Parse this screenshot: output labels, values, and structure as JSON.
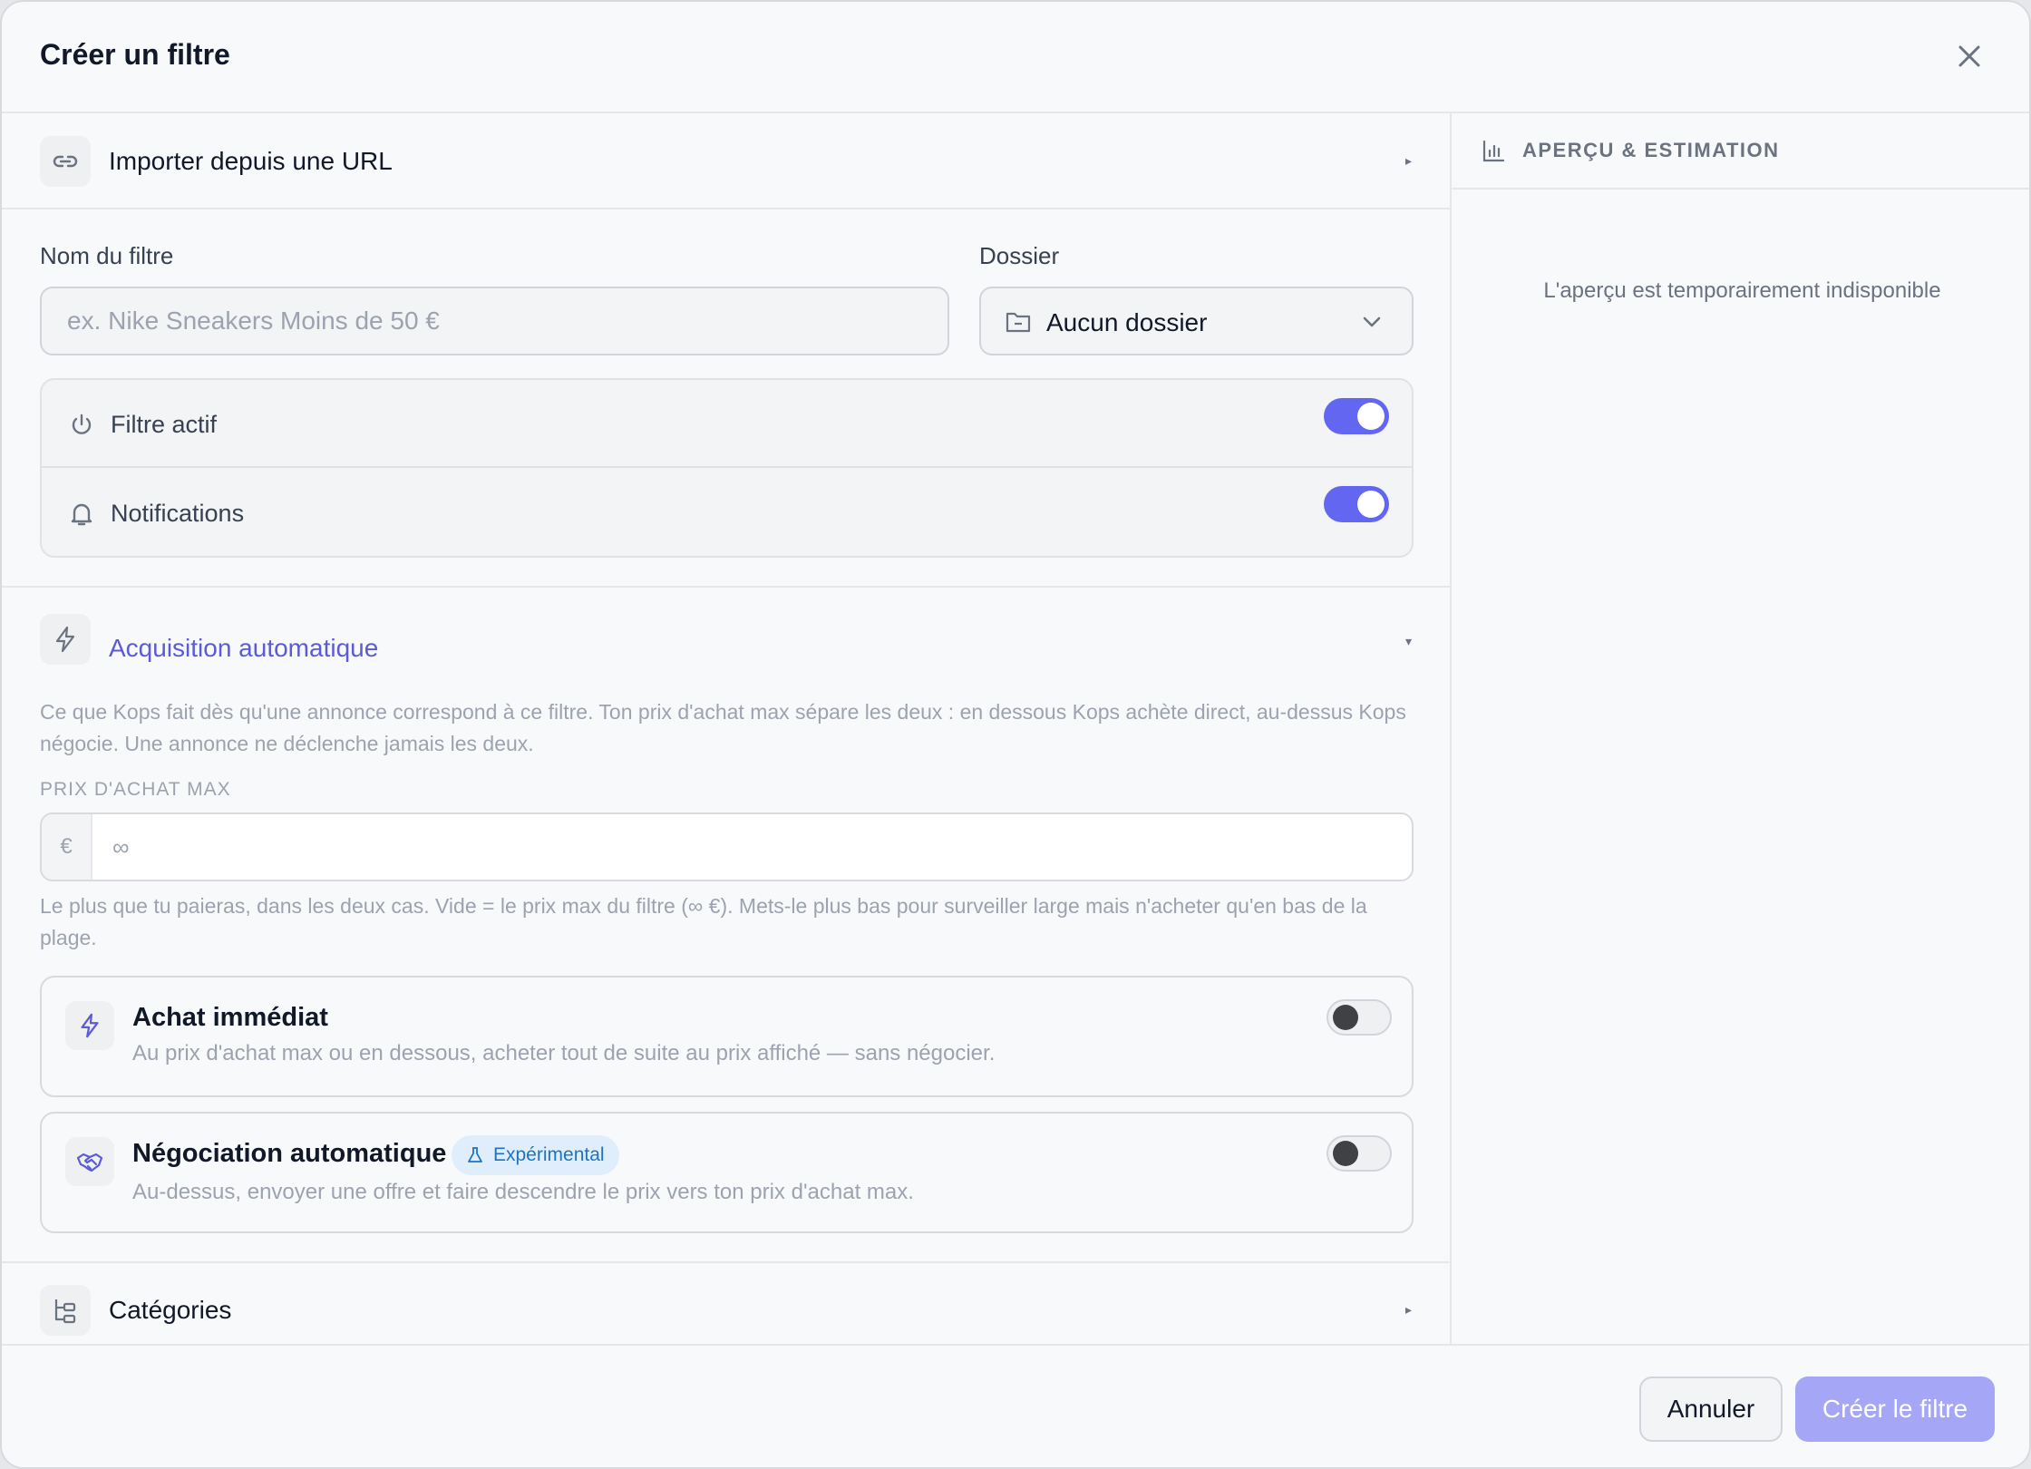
{
  "dialog": {
    "title": "Créer un filtre",
    "close_icon": "close-icon"
  },
  "import_section": {
    "label": "Importer depuis une URL",
    "icon": "link-icon",
    "caret": "▸"
  },
  "form": {
    "name_label": "Nom du filtre",
    "name_placeholder": "ex. Nike Sneakers Moins de 50 €",
    "name_value": "",
    "folder_label": "Dossier",
    "folder_value": "Aucun dossier",
    "folder_icon": "folder-icon"
  },
  "toggles": [
    {
      "label": "Filtre actif",
      "icon": "power-icon",
      "enabled": true
    },
    {
      "label": "Notifications",
      "icon": "bell-icon",
      "enabled": true
    }
  ],
  "acquisition": {
    "label": "Acquisition automatique",
    "icon": "lightning-icon",
    "caret": "▾",
    "description": "Ce que Kops fait dès qu'une annonce correspond à ce filtre. Ton prix d'achat max sépare les deux : en dessous Kops achète direct, au-dessus Kops négocie. Une annonce ne déclenche jamais les deux.",
    "max_price_label": "PRIX D'ACHAT MAX",
    "currency": "€",
    "max_price_placeholder": "∞",
    "max_price_value": "",
    "help": "Le plus que tu paieras, dans les deux cas. Vide = le prix max du filtre (∞ €). Mets-le plus bas pour surveiller large mais n'acheter qu'en bas de la plage.",
    "options": [
      {
        "title": "Achat immédiat",
        "description": "Au prix d'achat max ou en dessous, acheter tout de suite au prix affiché — sans négocier.",
        "icon": "lightning-icon",
        "enabled": false
      },
      {
        "title": "Négociation automatique",
        "badge": "Expérimental",
        "badge_icon": "flask-icon",
        "description": "Au-dessus, envoyer une offre et faire descendre le prix vers ton prix d'achat max.",
        "icon": "handshake-icon",
        "enabled": false
      }
    ]
  },
  "categories_section": {
    "label": "Catégories",
    "icon": "category-tree-icon",
    "caret": "▸"
  },
  "preview": {
    "title": "APERÇU & ESTIMATION",
    "icon": "bar-chart-icon",
    "message": "L'aperçu est temporairement indisponible"
  },
  "footer": {
    "cancel_label": "Annuler",
    "create_label": "Créer le filtre"
  },
  "colors": {
    "accent": "#6366f1",
    "accent_text": "#5b5bd6",
    "create_button_disabled": "#a5a6f6",
    "badge_bg": "#e0eefc",
    "badge_text": "#1d74c4"
  }
}
